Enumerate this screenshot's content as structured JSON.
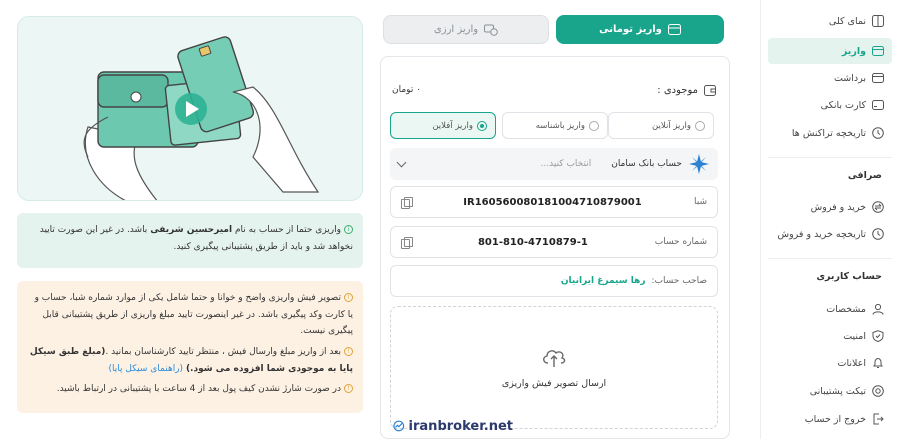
{
  "tabs": {
    "toman": "واریز تومانی",
    "crypto": "واریز ارزی"
  },
  "balance": {
    "label": "موجودی :",
    "value": "۰ تومان"
  },
  "deposit_methods": [
    "واریز آنلاین",
    "واریز باشناسه",
    "واریز آفلاین"
  ],
  "bank": {
    "name": "حساب بانک سامان",
    "placeholder": "انتخاب کنید..."
  },
  "sheba": {
    "label": "شبا",
    "value": "IR160560080181004710879001"
  },
  "account": {
    "label": "شماره حساب",
    "value": "801-810-4710879-1"
  },
  "owner": {
    "label": "صاحب حساب:",
    "value": "رها سیمرغ ایرانیان"
  },
  "upload": {
    "label": "ارسال تصویر فیش واریزی"
  },
  "note_green": {
    "text_a": "واریزی حتما از حساب به نام ",
    "name": "امیرحسین شریفی",
    "text_b": " باشد. در غیر این صورت تایید نخواهد شد و باید از طریق پشتیبانی پیگیری کنید."
  },
  "note_orange": {
    "p1": "تصویر فیش واریزی واضح و خوانا و حتما شامل یکی از موارد شماره شبا، حساب و یا کارت وکد پیگیری باشد. در غیر اینصورت تایید مبلغ واریزی از طریق پشتیبانی قابل پیگیری نیست.",
    "p2a": "بعد از واریز مبلغ وارسال فیش ، منتظر تایید کارشناسان بمانید .",
    "p2b": "(مبلغ طبق سیکل پایا به موجودی شما افزوده می شود.)",
    "p2c": " (راهنمای سیکل پایا)",
    "p3": "در صورت شارژ نشدن کیف پول بعد از 4 ساعت با پشتیبانی در ارتباط باشید."
  },
  "sidebar": {
    "items_top": [
      "نمای کلی",
      "واریز",
      "برداشت",
      "کارت بانکی",
      "تاریخچه تراکنش ها"
    ],
    "exchange_title": "صرافی",
    "exchange_items": [
      "خرید و فروش",
      "تاریخچه خرید و فروش"
    ],
    "account_title": "حساب کاربری",
    "account_items": [
      "مشخصات",
      "امنیت",
      "اعلانات",
      "تیکت پشتیبانی",
      "خروج از حساب"
    ]
  },
  "brand": "iranbroker.net",
  "colors": {
    "primary": "#18a58b",
    "green_note": "#e5f3ee",
    "orange_note": "#fdf1e4",
    "link": "#2a8cd8"
  },
  "icons": [
    "card-icon",
    "exchange-icon",
    "wallet-icon",
    "cloud-upload-icon",
    "copy-icon",
    "chevron-down-icon",
    "info-icon",
    "play-icon"
  ]
}
